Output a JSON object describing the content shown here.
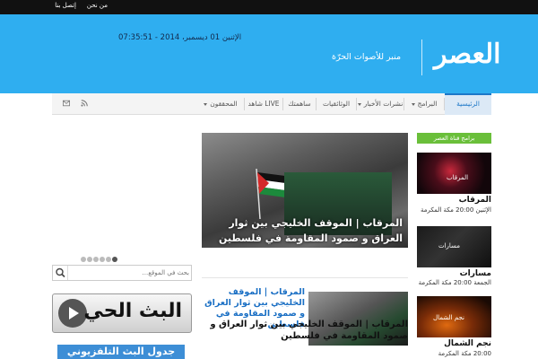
{
  "topbar": {
    "links": [
      "من نحن",
      "إتصل بنا"
    ]
  },
  "header": {
    "datetime": "الإثنين 01 ديسمبر، 2014 - 07:35:51",
    "logo_text": "العصر",
    "slogan": "منبر للأصوات الحرّة"
  },
  "nav": {
    "items": [
      "الرئيسية",
      "البرامج",
      "نشرات الأخبار",
      "الوثائقيات",
      "ساهمتك",
      "شاهد LIVE",
      "المحققون"
    ],
    "icons": [
      "rss-icon",
      "mail-icon"
    ]
  },
  "slider": {
    "caption": "المرقاب | الموقف الخليجي بين ثوار العراق و صمود المقاومة في فلسطين",
    "dots": 6,
    "active_dot": 6
  },
  "search": {
    "placeholder": "بحث في الموقع..."
  },
  "live": {
    "label": "البث الحي"
  },
  "schedule": {
    "label": "جدول البث التلفزيوني"
  },
  "post": {
    "title": "المرقاب | الموقف الخليجي بين ثوار العراق و صمود المقاومة في فلسطين",
    "excerpt": "المرقاب | الموقف الخليجي بين ثوار العراق و صمود المقاومة في فلسطين"
  },
  "sidebar": {
    "title": "برامج قناة العصر",
    "programs": [
      {
        "overlay": "المرقاب",
        "name": "المرقاب",
        "time": "الإثنين 20:00 مكة المكرمة"
      },
      {
        "overlay": "مسارات",
        "name": "مسارات",
        "time": "الجمعة 20:00 مكة المكرمة"
      },
      {
        "overlay": "نجم الشمال",
        "name": "نجم الشمال",
        "time": "20:00 مكة المكرمة"
      }
    ]
  },
  "colors": {
    "header": "#2faef0",
    "accent": "#1e78c8",
    "sidebar_title": "#6abf3a"
  }
}
